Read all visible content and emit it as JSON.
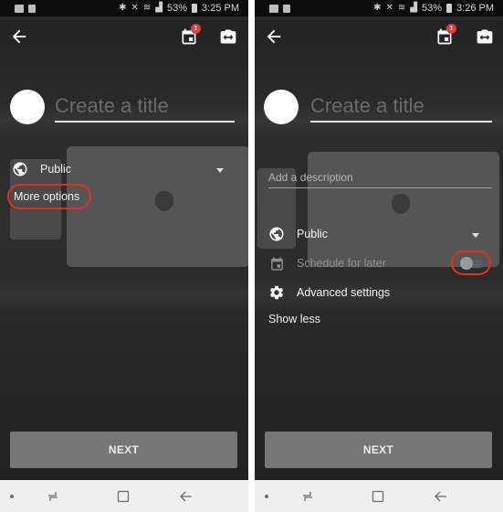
{
  "left_screen": {
    "status_bar": {
      "time": "3:25 PM",
      "battery": "53%"
    },
    "app_bar": {
      "notification_badge": "1"
    },
    "title_placeholder": "Create a title",
    "privacy": {
      "label": "Public"
    },
    "more_options_label": "More options",
    "next_label": "NEXT"
  },
  "right_screen": {
    "status_bar": {
      "time": "3:26 PM",
      "battery": "53%"
    },
    "app_bar": {
      "notification_badge": "1"
    },
    "title_placeholder": "Create a title",
    "description_placeholder": "Add a description",
    "privacy": {
      "label": "Public"
    },
    "schedule": {
      "label": "Schedule for later",
      "enabled": false
    },
    "advanced_settings_label": "Advanced settings",
    "show_less_label": "Show less",
    "next_label": "NEXT"
  },
  "colors": {
    "highlight": "#e0311e",
    "badge": "#e53935",
    "next_button": "#767676",
    "screen_background": "#2a2a2a",
    "nav_bar": "#efefef"
  },
  "icons": {
    "back": "arrow-left-icon",
    "calendar": "calendar-icon",
    "camera_flip": "camera-switch-icon",
    "globe": "globe-icon",
    "dropdown": "caret-down-icon",
    "gear": "gear-icon",
    "nav_recent": "recent-apps-icon",
    "nav_home": "home-icon",
    "nav_back": "nav-back-icon"
  }
}
